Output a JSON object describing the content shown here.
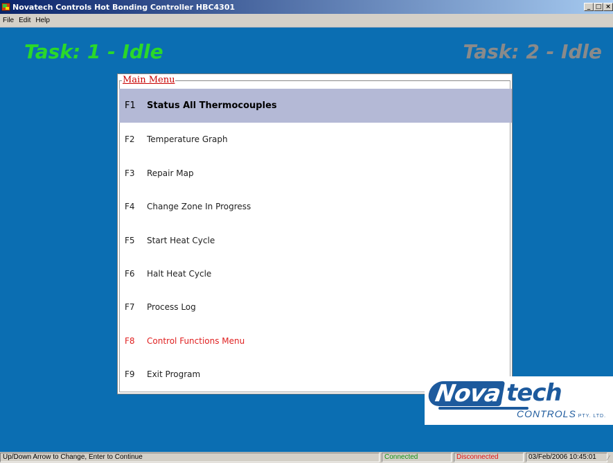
{
  "window": {
    "title": "Novatech Controls Hot Bonding Controller HBC4301",
    "icon": "novatech-app-icon",
    "buttons": {
      "minimize": "_",
      "maximize": "□",
      "close": "×"
    }
  },
  "menubar": [
    "File",
    "Edit",
    "Help"
  ],
  "tasks": {
    "task1": {
      "label": "Task: 1 - Idle",
      "color": "#2ad82a"
    },
    "task2": {
      "label": "Task: 2 - Idle",
      "color": "#8a8a8a"
    }
  },
  "main_menu": {
    "title": "Main Menu",
    "selected_index": 0,
    "items": [
      {
        "key": "F1",
        "label": "Status All Thermocouples"
      },
      {
        "key": "F2",
        "label": "Temperature Graph"
      },
      {
        "key": "F3",
        "label": "Repair Map"
      },
      {
        "key": "F4",
        "label": "Change Zone In Progress"
      },
      {
        "key": "F5",
        "label": "Start Heat Cycle"
      },
      {
        "key": "F6",
        "label": "Halt Heat Cycle"
      },
      {
        "key": "F7",
        "label": "Process Log"
      },
      {
        "key": "F8",
        "label": "Control Functions Menu"
      },
      {
        "key": "F9",
        "label": "Exit Program"
      }
    ]
  },
  "logo": {
    "brand_part1": "Nova",
    "brand_part2": "tech",
    "subtitle": "CONTROLS",
    "suffix": "PTY. LTD."
  },
  "statusbar": {
    "hint": "Up/Down Arrow to Change,  Enter to Continue",
    "connected": "Connected",
    "disconnected": "Disconnected",
    "datetime": "03/Feb/2006  10:45:01"
  },
  "colors": {
    "background": "#0b6eb2",
    "selected_row": "#b4b9d6",
    "menu_title": "#c80000",
    "highlight_item": "#e02020",
    "connected": "#109010",
    "disconnected": "#e01010"
  }
}
